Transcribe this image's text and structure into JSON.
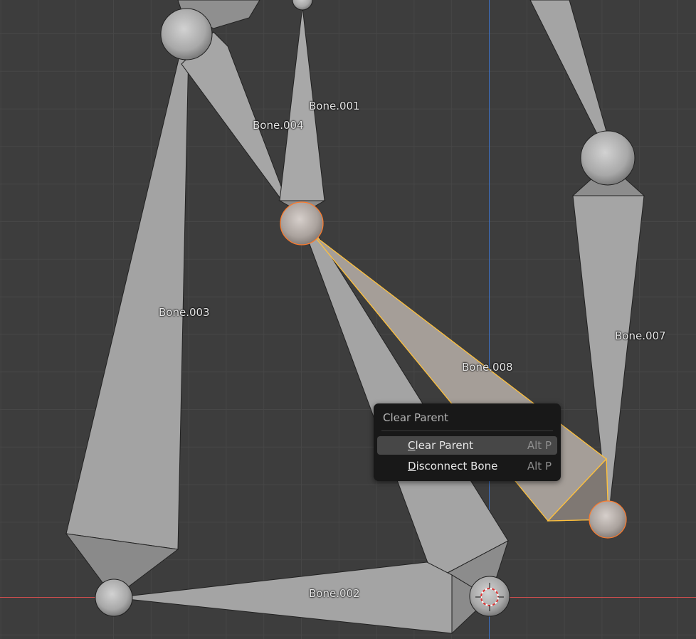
{
  "viewport": {
    "background": "#3d3d3d",
    "grid_color": "#474747",
    "axis_x_color": "#d04e4e",
    "axis_y_color": "#3d6fc0",
    "selection_color": "#ffc13c",
    "active_joint_color": "#ff7a2a"
  },
  "bones": [
    {
      "id": "bone-001",
      "label": "Bone.001"
    },
    {
      "id": "bone-002",
      "label": "Bone.002"
    },
    {
      "id": "bone-003",
      "label": "Bone.003"
    },
    {
      "id": "bone-004",
      "label": "Bone.004"
    },
    {
      "id": "bone-007",
      "label": "Bone.007"
    },
    {
      "id": "bone-008",
      "label": "Bone.008"
    }
  ],
  "context_menu": {
    "title": "Clear Parent",
    "items": [
      {
        "label_mnemonic": "C",
        "label_rest": "lear Parent",
        "shortcut": "Alt P",
        "active": true
      },
      {
        "label_mnemonic": "D",
        "label_rest": "isconnect Bone",
        "shortcut": "Alt P",
        "active": false
      }
    ]
  }
}
